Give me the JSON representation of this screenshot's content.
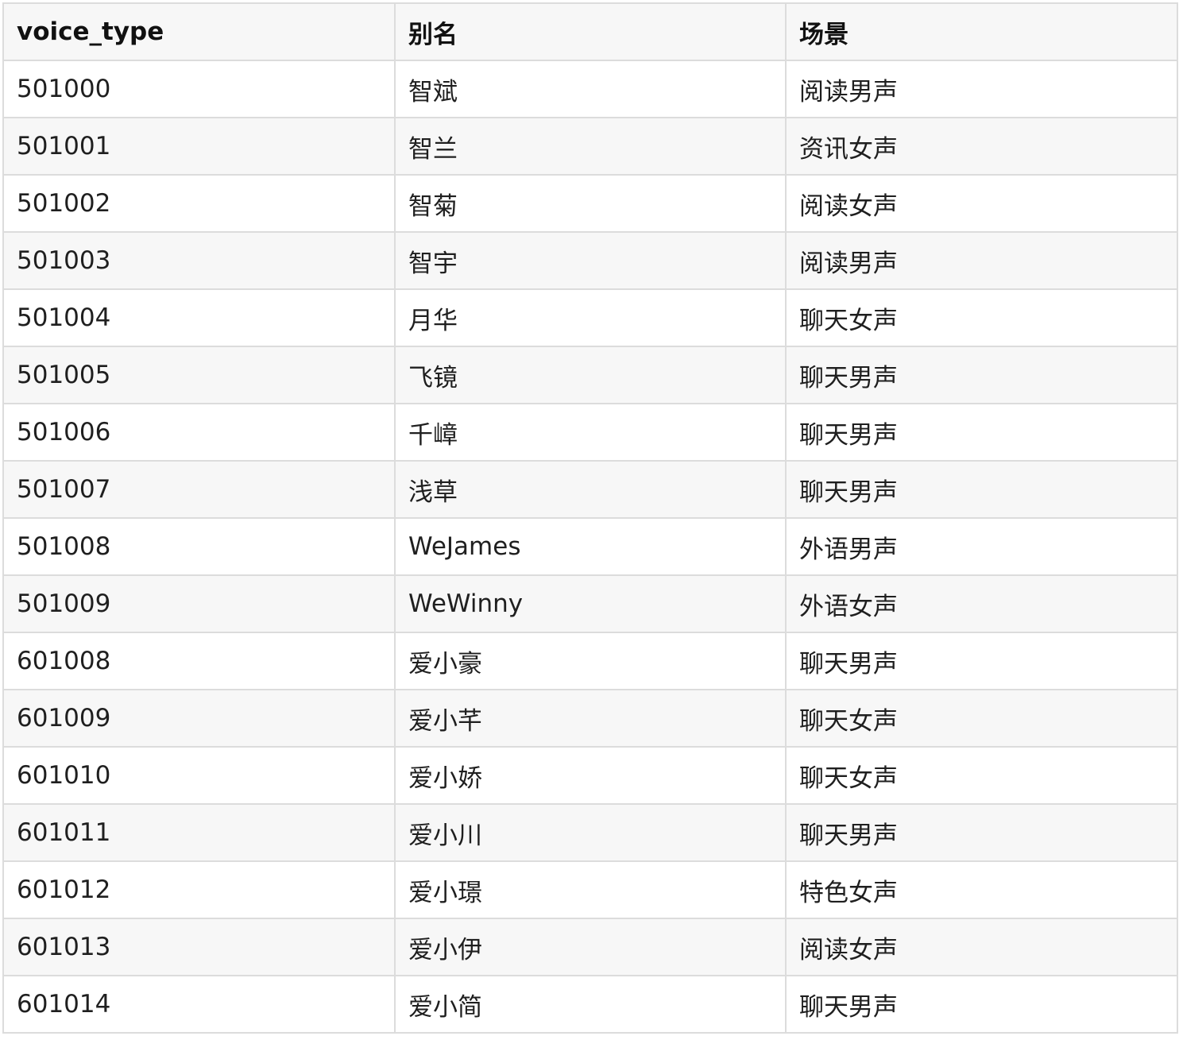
{
  "table": {
    "headers": [
      "voice_type",
      "别名",
      "场景"
    ],
    "rows": [
      [
        "501000",
        "智斌",
        "阅读男声"
      ],
      [
        "501001",
        "智兰",
        "资讯女声"
      ],
      [
        "501002",
        "智菊",
        "阅读女声"
      ],
      [
        "501003",
        "智宇",
        "阅读男声"
      ],
      [
        "501004",
        "月华",
        "聊天女声"
      ],
      [
        "501005",
        "飞镜",
        "聊天男声"
      ],
      [
        "501006",
        "千嶂",
        "聊天男声"
      ],
      [
        "501007",
        "浅草",
        "聊天男声"
      ],
      [
        "501008",
        "WeJames",
        "外语男声"
      ],
      [
        "501009",
        "WeWinny",
        "外语女声"
      ],
      [
        "601008",
        "爱小豪",
        "聊天男声"
      ],
      [
        "601009",
        "爱小芊",
        "聊天女声"
      ],
      [
        "601010",
        "爱小娇",
        "聊天女声"
      ],
      [
        "601011",
        "爱小川",
        "聊天男声"
      ],
      [
        "601012",
        "爱小璟",
        "特色女声"
      ],
      [
        "601013",
        "爱小伊",
        "阅读女声"
      ],
      [
        "601014",
        "爱小简",
        "聊天男声"
      ]
    ]
  }
}
